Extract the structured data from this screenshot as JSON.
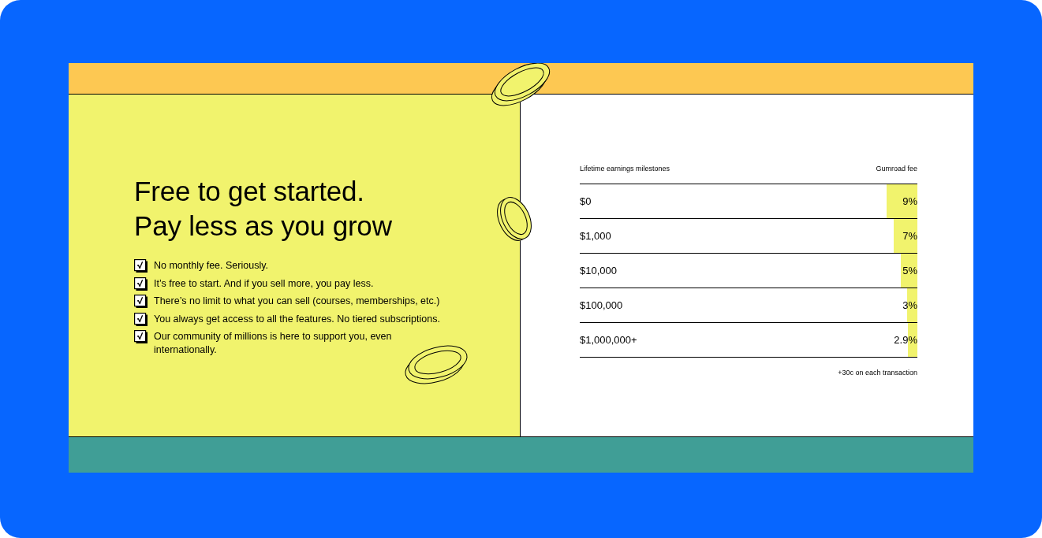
{
  "headline": [
    "Free to get started.",
    "Pay less as you grow"
  ],
  "features": [
    {
      "text": "No monthly fee. Seriously.",
      "checked": true
    },
    {
      "text": "It’s free to start. And if you sell more, you pay less.",
      "checked": true
    },
    {
      "text": "There’s no limit to what you can sell (courses, memberships, etc.)",
      "checked": true
    },
    {
      "text": "You always get access to all the features. No tiered subscriptions.",
      "checked": true
    },
    {
      "text": "Our community of millions is here to support you, even internationally.",
      "checked": true
    }
  ],
  "fee_table": {
    "columns": [
      "Lifetime earnings milestones",
      "Gumroad fee"
    ],
    "rows": [
      {
        "milestone": "$0",
        "fee": "9%",
        "level": 0.09
      },
      {
        "milestone": "$1,000",
        "fee": "7%",
        "level": 0.07
      },
      {
        "milestone": "$10,000",
        "fee": "5%",
        "level": 0.05
      },
      {
        "milestone": "$100,000",
        "fee": "3%",
        "level": 0.03
      },
      {
        "milestone": "$1,000,000+",
        "fee": "2.9%",
        "level": 0.029
      }
    ],
    "footnote": "+30c on each transaction"
  }
}
